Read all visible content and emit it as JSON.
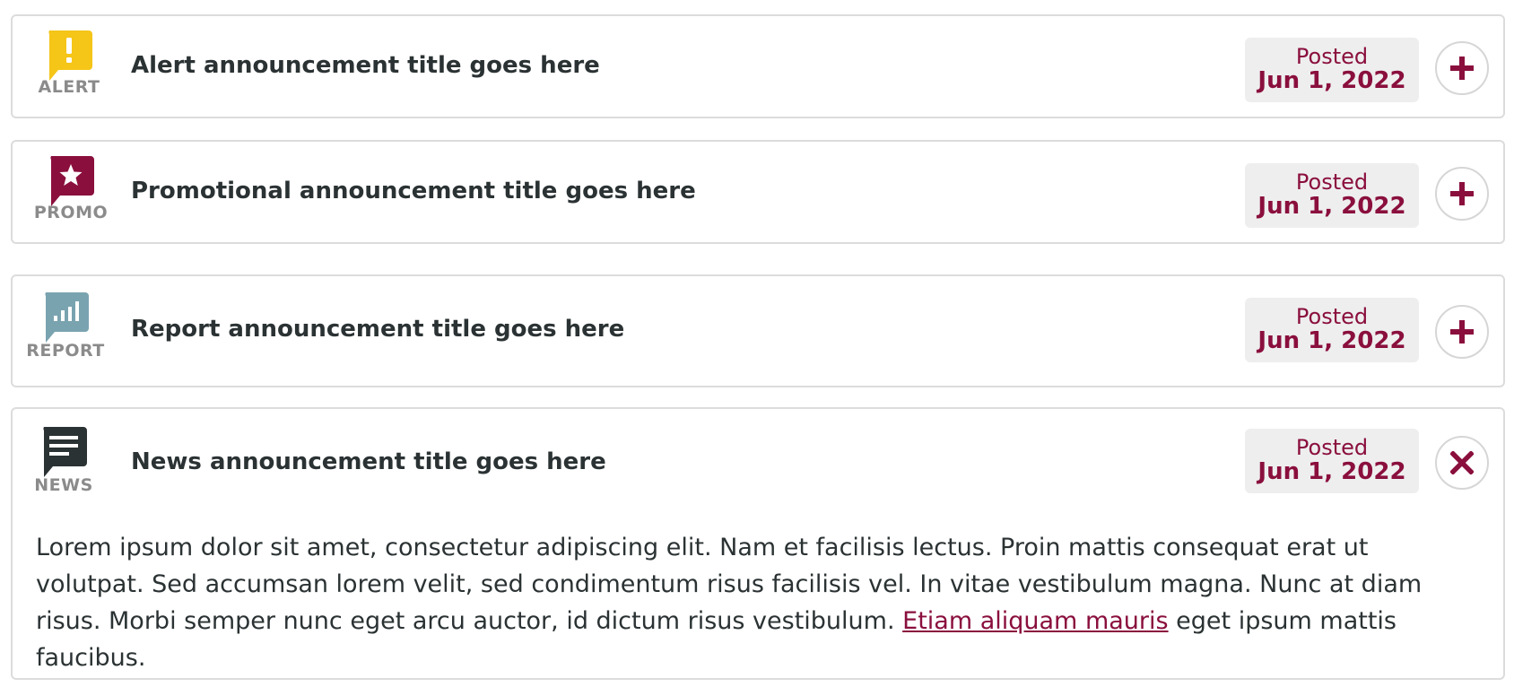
{
  "announcements": [
    {
      "type_label": "ALERT",
      "icon": "alert-icon",
      "icon_color": "#f5c518",
      "title": "Alert announcement title goes here",
      "posted_label": "Posted",
      "posted_date": "Jun 1, 2022",
      "expanded": false
    },
    {
      "type_label": "PROMO",
      "icon": "star-icon",
      "icon_color": "#8a0f3d",
      "title": "Promotional announcement title goes here",
      "posted_label": "Posted",
      "posted_date": "Jun 1, 2022",
      "expanded": false
    },
    {
      "type_label": "REPORT",
      "icon": "bar-chart-icon",
      "icon_color": "#7aa3b0",
      "title": "Report announcement title goes here",
      "posted_label": "Posted",
      "posted_date": "Jun 1, 2022",
      "expanded": false
    },
    {
      "type_label": "NEWS",
      "icon": "news-icon",
      "icon_color": "#2b3233",
      "title": "News announcement title goes here",
      "posted_label": "Posted",
      "posted_date": "Jun 1, 2022",
      "expanded": true,
      "body_before_link": "Lorem ipsum dolor sit amet, consectetur adipiscing elit. Nam et facilisis lectus. Proin mattis consequat erat ut volutpat. Sed accumsan lorem velit, sed condimentum risus facilisis vel. In vitae vestibulum magna. Nunc at diam risus. Morbi semper nunc eget arcu auctor, id dictum risus vestibulum.",
      "body_link": "Etiam aliquam mauris",
      "body_after_link": "eget ipsum mattis faucibus."
    }
  ],
  "colors": {
    "accent": "#8a0f3d",
    "date_bg": "#eeeeee",
    "border": "#dcdcdc",
    "text": "#2b3233",
    "muted": "#8b8b8b"
  }
}
